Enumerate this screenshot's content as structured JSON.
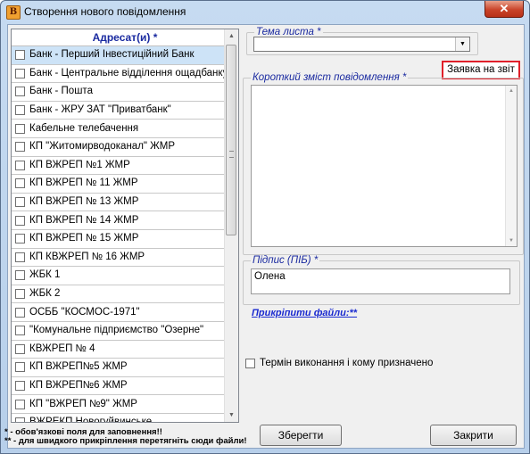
{
  "window": {
    "title": "Створення нового повідомлення",
    "close_glyph": "✕",
    "app_icon_glyph": "B"
  },
  "recipients": {
    "header": "Адресат(и) *",
    "items": [
      "Банк - Перший Інвестиційний Банк",
      "Банк - Центральне відділення ощадбанку",
      "Банк - Пошта",
      "Банк - ЖРУ ЗАТ \"Приватбанк\"",
      "Кабельне телебачення",
      "КП \"Житомирводоканал\" ЖМР",
      "КП ВЖРЕП №1 ЖМР",
      "КП ВЖРЕП № 11 ЖМР",
      "КП ВЖРЕП № 13 ЖМР",
      "КП ВЖРЕП № 14 ЖМР",
      "КП ВЖРЕП № 15 ЖМР",
      "КП КВЖРЕП № 16 ЖМР",
      "ЖБК 1",
      "ЖБК 2",
      "ОСББ \"КОСМОС-1971\"",
      "\"Комунальне підприємство \"Озерне\"",
      "КВЖРЕП № 4",
      "КП ВЖРЕП№5 ЖМР",
      "КП ВЖРЕП№6 ЖМР",
      "КП \"ВЖРЕП №9\" ЖМР",
      "ВЖРЕКП Новогуйвинське"
    ]
  },
  "subject": {
    "legend": "Тема листа *",
    "value": ""
  },
  "request_button": {
    "label": "Заявка на звіт"
  },
  "summary": {
    "legend": "Короткий зміст повідомлення *",
    "value": ""
  },
  "signature": {
    "legend": "Підпис (ПІБ) *",
    "value": "Олена"
  },
  "attach_link": {
    "label": "Прикріпити файли:**"
  },
  "term_checkbox": {
    "label": "Термін виконання і кому призначено"
  },
  "buttons": {
    "save": "Зберегти",
    "close": "Закрити"
  },
  "notes": {
    "line1": "* - обов'язкові поля для заповнення!!",
    "line2": "** - для швидкого прикріплення перетягніть сюди файли!"
  }
}
